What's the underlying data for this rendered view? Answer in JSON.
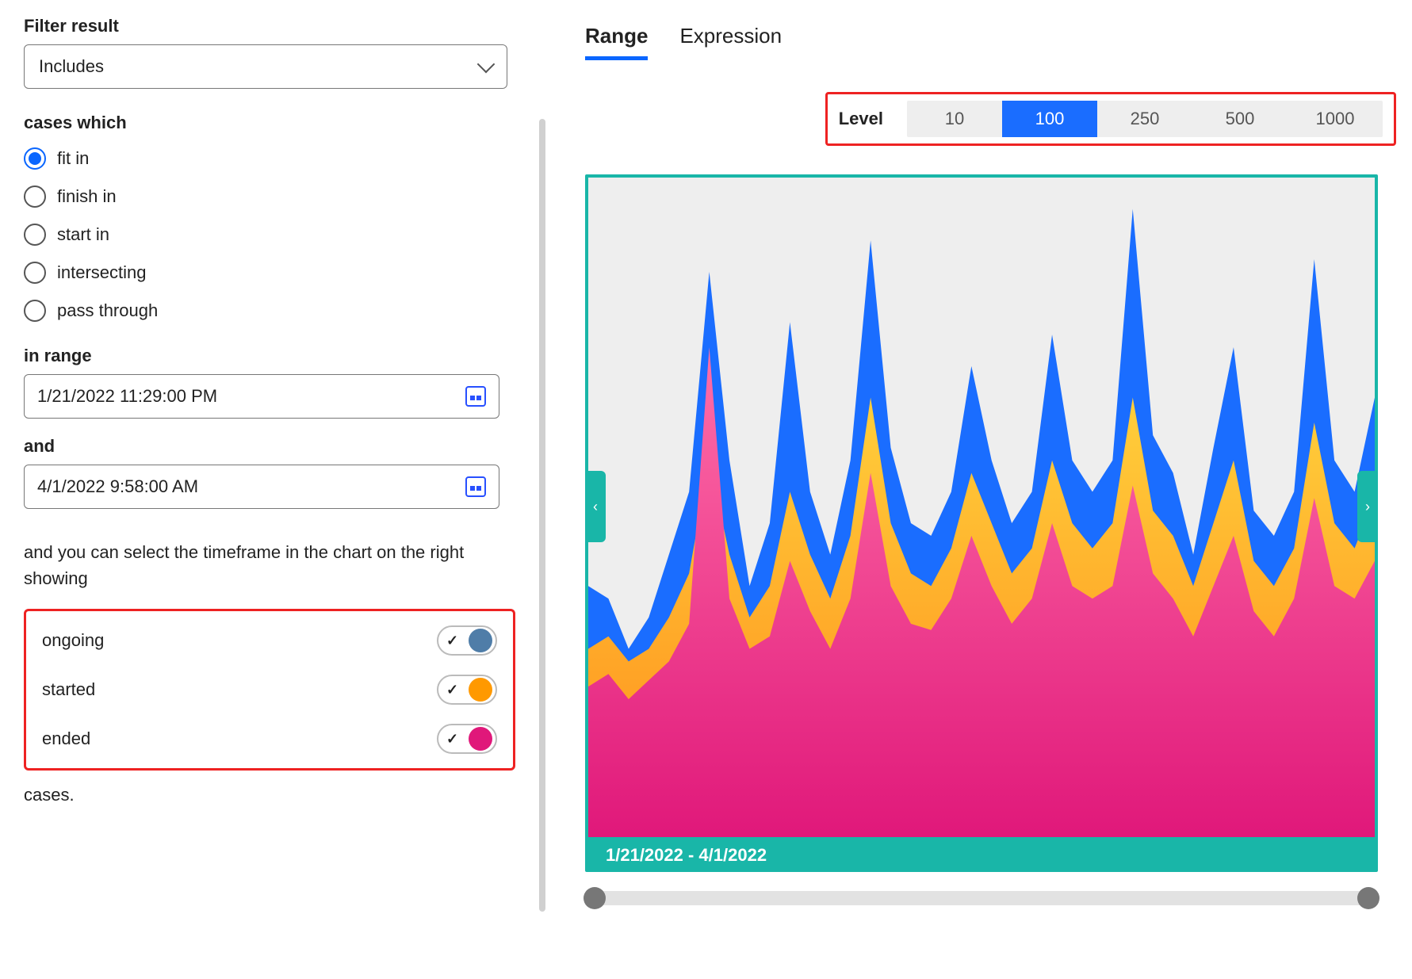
{
  "left": {
    "filter_label": "Filter result",
    "filter_value": "Includes",
    "cases_label": "cases which",
    "radios": [
      {
        "label": "fit in",
        "checked": true
      },
      {
        "label": "finish in",
        "checked": false
      },
      {
        "label": "start in",
        "checked": false
      },
      {
        "label": "intersecting",
        "checked": false
      },
      {
        "label": "pass through",
        "checked": false
      }
    ],
    "in_range_label": "in range",
    "date_start": "1/21/2022 11:29:00 PM",
    "and_label": "and",
    "date_end": "4/1/2022 9:58:00 AM",
    "sentence": "and you can select the timeframe in the chart on the right showing",
    "toggles": [
      {
        "label": "ongoing",
        "color": "#4f7da8",
        "on": true
      },
      {
        "label": "started",
        "color": "#ff9900",
        "on": true
      },
      {
        "label": "ended",
        "color": "#e0187a",
        "on": true
      }
    ],
    "trail": "cases."
  },
  "right": {
    "tabs": [
      {
        "label": "Range",
        "active": true
      },
      {
        "label": "Expression",
        "active": false
      }
    ],
    "level_label": "Level",
    "levels": [
      {
        "label": "10",
        "active": false
      },
      {
        "label": "100",
        "active": true
      },
      {
        "label": "250",
        "active": false
      },
      {
        "label": "500",
        "active": false
      },
      {
        "label": "1000",
        "active": false
      }
    ],
    "chart_range_text": "1/21/2022 - 4/1/2022"
  },
  "chart_data": {
    "type": "area",
    "title": "",
    "xlabel": "",
    "ylabel": "",
    "x_range": [
      "1/21/2022",
      "4/1/2022"
    ],
    "ylim": [
      0,
      100
    ],
    "note": "x-axis represents equal time buckets across the date range; y-values are relative counts (0-100) estimated from the chart peaks",
    "series": [
      {
        "name": "ongoing",
        "color": "#1a6dff",
        "values": [
          40,
          38,
          30,
          35,
          45,
          55,
          90,
          60,
          40,
          50,
          82,
          55,
          45,
          60,
          95,
          62,
          50,
          48,
          55,
          75,
          60,
          50,
          55,
          80,
          60,
          55,
          60,
          100,
          64,
          58,
          45,
          62,
          78,
          52,
          48,
          55,
          92,
          60,
          55,
          70
        ]
      },
      {
        "name": "started",
        "color": "#ff9900",
        "values": [
          30,
          32,
          28,
          30,
          35,
          42,
          60,
          45,
          35,
          40,
          55,
          45,
          38,
          48,
          70,
          50,
          42,
          40,
          46,
          58,
          50,
          42,
          46,
          60,
          50,
          46,
          50,
          70,
          52,
          48,
          40,
          50,
          60,
          44,
          40,
          46,
          66,
          50,
          46,
          54
        ]
      },
      {
        "name": "ended",
        "color": "#e0187a",
        "values": [
          24,
          26,
          22,
          25,
          28,
          34,
          78,
          38,
          30,
          32,
          44,
          36,
          30,
          38,
          58,
          40,
          34,
          33,
          38,
          48,
          40,
          34,
          38,
          50,
          40,
          38,
          40,
          56,
          42,
          38,
          32,
          40,
          48,
          36,
          32,
          38,
          54,
          40,
          38,
          44
        ]
      }
    ]
  }
}
